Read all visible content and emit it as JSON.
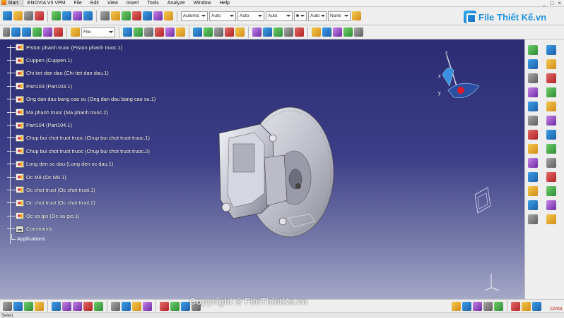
{
  "menu": {
    "start": "Start",
    "items": [
      "ENOVIA V5 VPM",
      "File",
      "Edit",
      "View",
      "Insert",
      "Tools",
      "Analyze",
      "Window",
      "Help"
    ]
  },
  "toolbar": {
    "file_combo": "File",
    "combos": [
      "Automa",
      "Auto",
      "Auto",
      "Auto",
      "Auto",
      "None"
    ]
  },
  "tree": {
    "nodes": [
      "Piston phanh truoc (Piston phanh truoc.1)",
      "Cuppen (Cuppen.1)",
      "Chi tiet dan dau (Chi tiet dan dau.1)",
      "Part103 (Part103.1)",
      "Ong dan dau bang cao su (Ong dan dau bang cao su.1)",
      "Ma phanh truoc (Ma phanh truoc.2)",
      "Part104 (Part104.1)",
      "Chup bui chot truot truoc (Chup bui chot truot truoc.1)",
      "Chup bui chot truot truoc (Chup bui chot truot truoc.2)",
      "Long den oc dau (Long den oc dau.1)",
      "Oc M8 (Oc M8.1)",
      "Oc chot truot (Oc chot truot.1)",
      "Oc chot truot (Oc chot truot.2)",
      "Oc xa gio (Oc xa gio.1)"
    ],
    "constraints": "Constraints",
    "applications": "Applications"
  },
  "watermark": {
    "logo_text": "File Thiết Kế.vn",
    "copyright": "Copyright © FileThietKe.vn"
  },
  "brand": "CATIA",
  "window_controls": [
    "_",
    "□",
    "×"
  ],
  "status_text": "Select",
  "colors": {
    "viewport_top": "#2b2c73",
    "viewport_bottom": "#a5a8c6",
    "toolbar_bg": "#eeeeee",
    "logo_blue": "#1e8fe0"
  }
}
